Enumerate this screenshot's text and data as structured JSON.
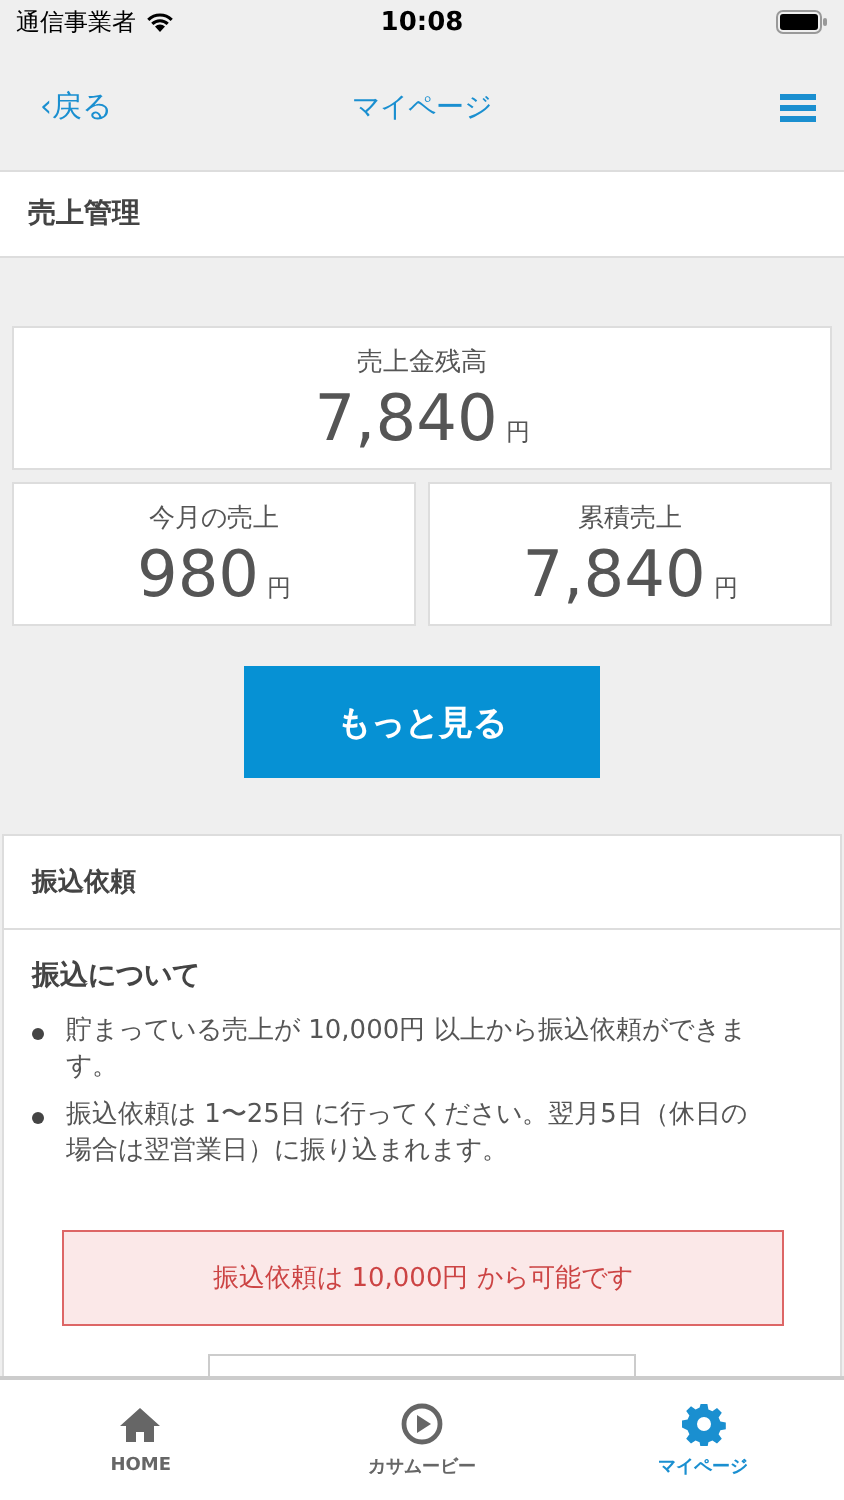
{
  "status_bar": {
    "carrier": "通信事業者",
    "time": "10:08"
  },
  "nav_bar": {
    "back": "‹戻る",
    "title": "マイページ"
  },
  "section_title": "売上管理",
  "balance": {
    "label": "売上金残高",
    "amount": "7,840",
    "unit": "円"
  },
  "stats": [
    {
      "label": "今月の売上",
      "amount": "980",
      "unit": "円"
    },
    {
      "label": "累積売上",
      "amount": "7,840",
      "unit": "円"
    }
  ],
  "more_button": "もっと見る",
  "transfer": {
    "title": "振込依頼",
    "subtitle": "振込について",
    "notes": [
      "貯まっている売上が 10,000円 以上から振込依頼ができます。",
      "振込依頼は 1〜25日 に行ってください。翌月5日（休日の場合は翌営業日）に振り込まれます。"
    ],
    "alert": "振込依頼は 10,000円 から可能です"
  },
  "tabs": [
    {
      "kind": "home",
      "label": "HOME",
      "selected": false
    },
    {
      "kind": "play",
      "label": "カサムービー",
      "selected": false
    },
    {
      "kind": "gear",
      "label": "マイページ",
      "selected": true
    }
  ]
}
